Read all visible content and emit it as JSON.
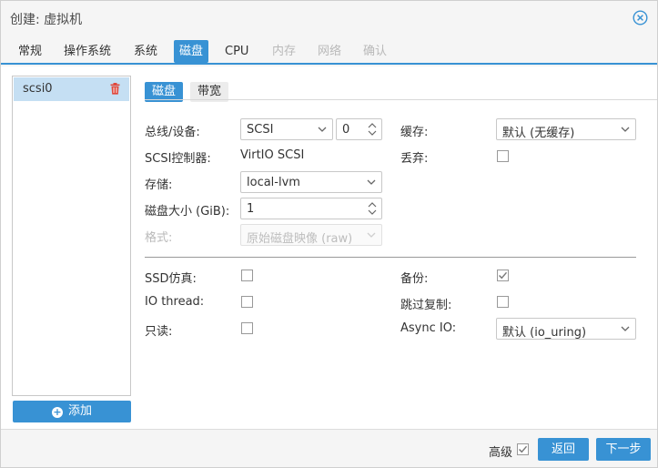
{
  "window": {
    "title": "创建: 虚拟机"
  },
  "tabs": [
    {
      "label": "常规"
    },
    {
      "label": "操作系统"
    },
    {
      "label": "系统"
    },
    {
      "label": "磁盘"
    },
    {
      "label": "CPU"
    },
    {
      "label": "内存"
    },
    {
      "label": "网络"
    },
    {
      "label": "确认"
    }
  ],
  "disk_list": {
    "items": [
      {
        "label": "scsi0"
      }
    ],
    "add_label": "添加"
  },
  "subtabs": [
    {
      "label": "磁盘"
    },
    {
      "label": "带宽"
    }
  ],
  "form": {
    "bus_label": "总线/设备:",
    "bus_value": "SCSI",
    "device_index": "0",
    "controller_label": "SCSI控制器:",
    "controller_value": "VirtIO SCSI",
    "storage_label": "存储:",
    "storage_value": "local-lvm",
    "size_label": "磁盘大小 (GiB):",
    "size_value": "1",
    "format_label": "格式:",
    "format_value": "原始磁盘映像 (raw)",
    "cache_label": "缓存:",
    "cache_value": "默认 (无缓存)",
    "discard_label": "丢弃:",
    "ssd_label": "SSD仿真:",
    "iothread_label": "IO thread:",
    "readonly_label": "只读:",
    "backup_label": "备份:",
    "skip_repl_label": "跳过复制:",
    "asyncio_label": "Async IO:",
    "asyncio_value": "默认 (io_uring)"
  },
  "checkbox_state": {
    "discard": false,
    "ssd": false,
    "iothread": false,
    "readonly": false,
    "backup": true,
    "skip_repl": false
  },
  "footer": {
    "advanced_label": "高级",
    "back_label": "返回",
    "next_label": "下一步"
  },
  "colors": {
    "accent": "#3892d4",
    "selected_row": "#c5dff3",
    "delete_icon": "#e0483c"
  },
  "icons": [
    "close-circle-icon",
    "trash-icon",
    "plus-circle-icon",
    "chevron-down-icon",
    "spinner-icon",
    "checkmark-icon"
  ]
}
